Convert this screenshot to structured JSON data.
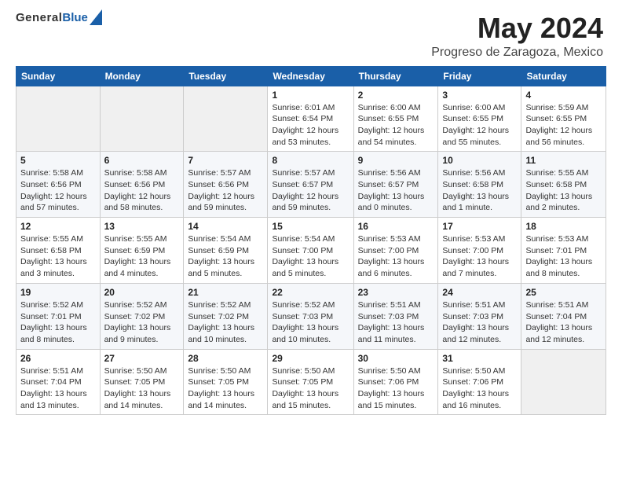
{
  "header": {
    "logo_general": "General",
    "logo_blue": "Blue",
    "month_title": "May 2024",
    "location": "Progreso de Zaragoza, Mexico"
  },
  "days_of_week": [
    "Sunday",
    "Monday",
    "Tuesday",
    "Wednesday",
    "Thursday",
    "Friday",
    "Saturday"
  ],
  "weeks": [
    [
      {
        "day": "",
        "info": ""
      },
      {
        "day": "",
        "info": ""
      },
      {
        "day": "",
        "info": ""
      },
      {
        "day": "1",
        "info": "Sunrise: 6:01 AM\nSunset: 6:54 PM\nDaylight: 12 hours\nand 53 minutes."
      },
      {
        "day": "2",
        "info": "Sunrise: 6:00 AM\nSunset: 6:55 PM\nDaylight: 12 hours\nand 54 minutes."
      },
      {
        "day": "3",
        "info": "Sunrise: 6:00 AM\nSunset: 6:55 PM\nDaylight: 12 hours\nand 55 minutes."
      },
      {
        "day": "4",
        "info": "Sunrise: 5:59 AM\nSunset: 6:55 PM\nDaylight: 12 hours\nand 56 minutes."
      }
    ],
    [
      {
        "day": "5",
        "info": "Sunrise: 5:58 AM\nSunset: 6:56 PM\nDaylight: 12 hours\nand 57 minutes."
      },
      {
        "day": "6",
        "info": "Sunrise: 5:58 AM\nSunset: 6:56 PM\nDaylight: 12 hours\nand 58 minutes."
      },
      {
        "day": "7",
        "info": "Sunrise: 5:57 AM\nSunset: 6:56 PM\nDaylight: 12 hours\nand 59 minutes."
      },
      {
        "day": "8",
        "info": "Sunrise: 5:57 AM\nSunset: 6:57 PM\nDaylight: 12 hours\nand 59 minutes."
      },
      {
        "day": "9",
        "info": "Sunrise: 5:56 AM\nSunset: 6:57 PM\nDaylight: 13 hours\nand 0 minutes."
      },
      {
        "day": "10",
        "info": "Sunrise: 5:56 AM\nSunset: 6:58 PM\nDaylight: 13 hours\nand 1 minute."
      },
      {
        "day": "11",
        "info": "Sunrise: 5:55 AM\nSunset: 6:58 PM\nDaylight: 13 hours\nand 2 minutes."
      }
    ],
    [
      {
        "day": "12",
        "info": "Sunrise: 5:55 AM\nSunset: 6:58 PM\nDaylight: 13 hours\nand 3 minutes."
      },
      {
        "day": "13",
        "info": "Sunrise: 5:55 AM\nSunset: 6:59 PM\nDaylight: 13 hours\nand 4 minutes."
      },
      {
        "day": "14",
        "info": "Sunrise: 5:54 AM\nSunset: 6:59 PM\nDaylight: 13 hours\nand 5 minutes."
      },
      {
        "day": "15",
        "info": "Sunrise: 5:54 AM\nSunset: 7:00 PM\nDaylight: 13 hours\nand 5 minutes."
      },
      {
        "day": "16",
        "info": "Sunrise: 5:53 AM\nSunset: 7:00 PM\nDaylight: 13 hours\nand 6 minutes."
      },
      {
        "day": "17",
        "info": "Sunrise: 5:53 AM\nSunset: 7:00 PM\nDaylight: 13 hours\nand 7 minutes."
      },
      {
        "day": "18",
        "info": "Sunrise: 5:53 AM\nSunset: 7:01 PM\nDaylight: 13 hours\nand 8 minutes."
      }
    ],
    [
      {
        "day": "19",
        "info": "Sunrise: 5:52 AM\nSunset: 7:01 PM\nDaylight: 13 hours\nand 8 minutes."
      },
      {
        "day": "20",
        "info": "Sunrise: 5:52 AM\nSunset: 7:02 PM\nDaylight: 13 hours\nand 9 minutes."
      },
      {
        "day": "21",
        "info": "Sunrise: 5:52 AM\nSunset: 7:02 PM\nDaylight: 13 hours\nand 10 minutes."
      },
      {
        "day": "22",
        "info": "Sunrise: 5:52 AM\nSunset: 7:03 PM\nDaylight: 13 hours\nand 10 minutes."
      },
      {
        "day": "23",
        "info": "Sunrise: 5:51 AM\nSunset: 7:03 PM\nDaylight: 13 hours\nand 11 minutes."
      },
      {
        "day": "24",
        "info": "Sunrise: 5:51 AM\nSunset: 7:03 PM\nDaylight: 13 hours\nand 12 minutes."
      },
      {
        "day": "25",
        "info": "Sunrise: 5:51 AM\nSunset: 7:04 PM\nDaylight: 13 hours\nand 12 minutes."
      }
    ],
    [
      {
        "day": "26",
        "info": "Sunrise: 5:51 AM\nSunset: 7:04 PM\nDaylight: 13 hours\nand 13 minutes."
      },
      {
        "day": "27",
        "info": "Sunrise: 5:50 AM\nSunset: 7:05 PM\nDaylight: 13 hours\nand 14 minutes."
      },
      {
        "day": "28",
        "info": "Sunrise: 5:50 AM\nSunset: 7:05 PM\nDaylight: 13 hours\nand 14 minutes."
      },
      {
        "day": "29",
        "info": "Sunrise: 5:50 AM\nSunset: 7:05 PM\nDaylight: 13 hours\nand 15 minutes."
      },
      {
        "day": "30",
        "info": "Sunrise: 5:50 AM\nSunset: 7:06 PM\nDaylight: 13 hours\nand 15 minutes."
      },
      {
        "day": "31",
        "info": "Sunrise: 5:50 AM\nSunset: 7:06 PM\nDaylight: 13 hours\nand 16 minutes."
      },
      {
        "day": "",
        "info": ""
      }
    ]
  ]
}
